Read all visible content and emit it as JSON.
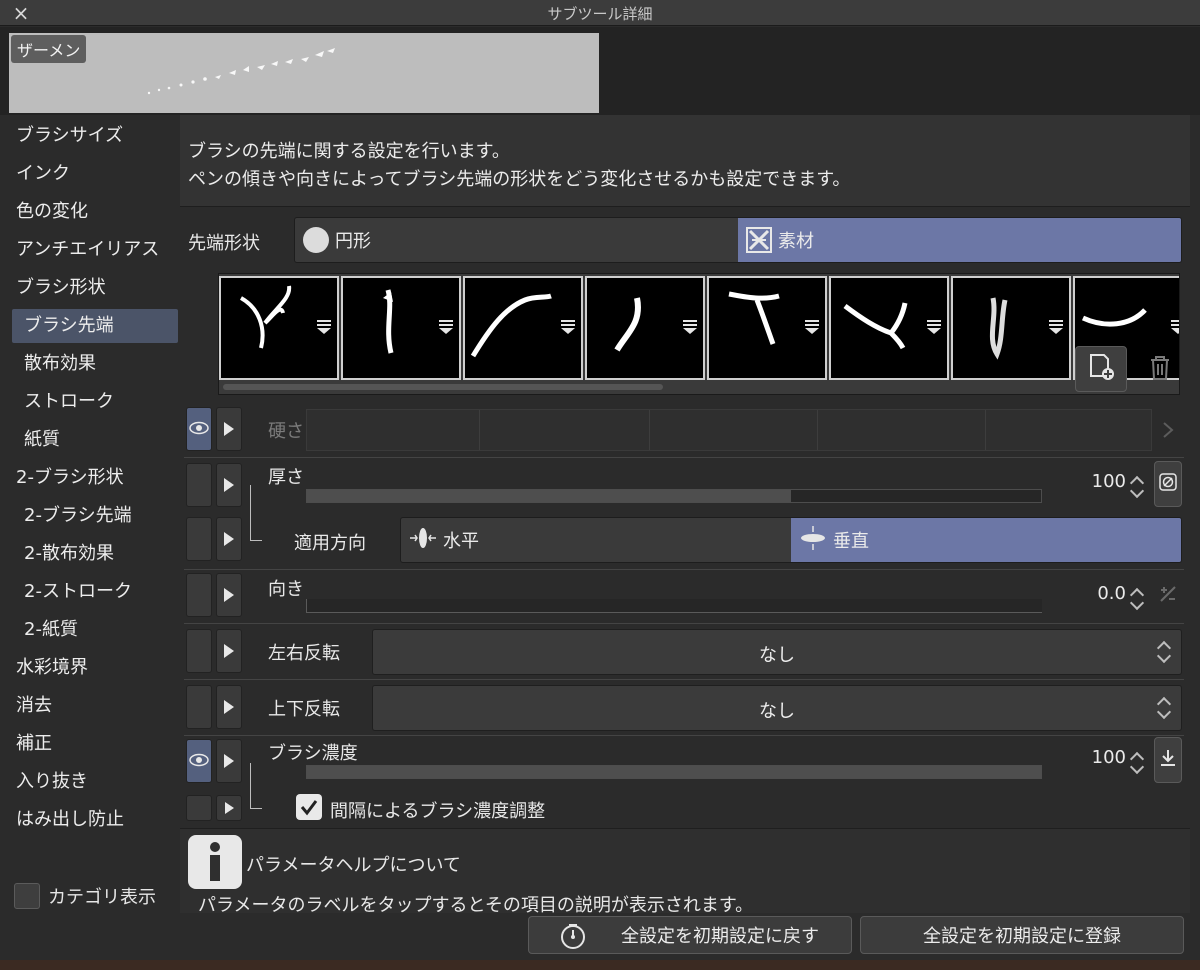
{
  "window": {
    "title": "サブツール詳細",
    "close_icon": "×"
  },
  "preview": {
    "brush_name": "ザーメン"
  },
  "sidebar": {
    "items": [
      {
        "label": "ブラシサイズ"
      },
      {
        "label": "インク"
      },
      {
        "label": "色の変化"
      },
      {
        "label": "アンチエイリアス"
      },
      {
        "label": "ブラシ形状"
      },
      {
        "label": "ブラシ先端"
      },
      {
        "label": "散布効果"
      },
      {
        "label": "ストローク"
      },
      {
        "label": "紙質"
      },
      {
        "label": "2-ブラシ形状"
      },
      {
        "label": "2-ブラシ先端"
      },
      {
        "label": "2-散布効果"
      },
      {
        "label": "2-ストローク"
      },
      {
        "label": "2-紙質"
      },
      {
        "label": "水彩境界"
      },
      {
        "label": "消去"
      },
      {
        "label": "補正"
      },
      {
        "label": "入り抜き"
      },
      {
        "label": "はみ出し防止"
      }
    ],
    "selected": "ブラシ先端",
    "category_label": "カテゴリ表示"
  },
  "description": {
    "line1": "ブラシの先端に関する設定を行います。",
    "line2": "ペンの傾きや向きによってブラシ先端の形状をどう変化させるかも設定できます。"
  },
  "tip_shape": {
    "label": "先端形状",
    "options": [
      "円形",
      "素材"
    ],
    "selected": "素材"
  },
  "params": {
    "hardness": {
      "label": "硬さ"
    },
    "thickness": {
      "label": "厚さ",
      "value": "100",
      "fill_percent": 66
    },
    "direction_apply": {
      "label": "適用方向",
      "options": [
        "水平",
        "垂直"
      ],
      "selected": "垂直"
    },
    "orientation": {
      "label": "向き",
      "value": "0.0",
      "fill_percent": 0
    },
    "flip_h": {
      "label": "左右反転",
      "value": "なし"
    },
    "flip_v": {
      "label": "上下反転",
      "value": "なし"
    },
    "density": {
      "label": "ブラシ濃度",
      "value": "100",
      "fill_percent": 100
    },
    "spacing_density": {
      "label": "間隔によるブラシ濃度調整",
      "checked": true
    }
  },
  "help": {
    "title": "パラメータヘルプについて",
    "text": "パラメータのラベルをタップするとその項目の説明が表示されます。"
  },
  "footer": {
    "reset_label": "全設定を初期設定に戻す",
    "register_label": "全設定を初期設定に登録"
  }
}
